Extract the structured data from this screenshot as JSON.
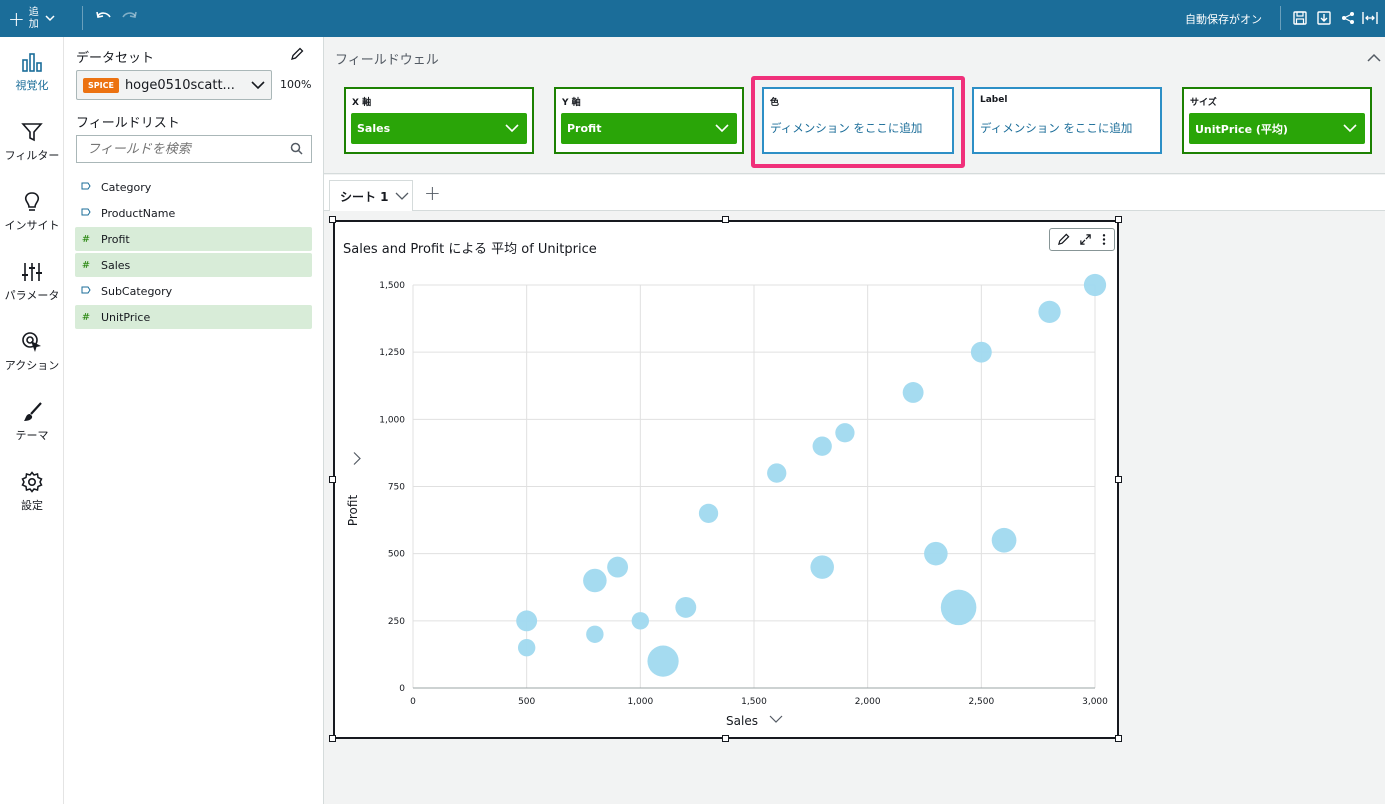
{
  "topbar": {
    "add_label": "追加",
    "autosave": "自動保存がオン"
  },
  "rail": [
    {
      "label": "視覚化",
      "icon": "visualize-icon",
      "active": true
    },
    {
      "label": "フィルター",
      "icon": "filter-icon",
      "active": false
    },
    {
      "label": "インサイト",
      "icon": "lightbulb-icon",
      "active": false
    },
    {
      "label": "パラメータ",
      "icon": "sliders-icon",
      "active": false
    },
    {
      "label": "アクション",
      "icon": "action-cursor-icon",
      "active": false
    },
    {
      "label": "テーマ",
      "icon": "brush-icon",
      "active": false
    },
    {
      "label": "設定",
      "icon": "gear-icon",
      "active": false
    }
  ],
  "datapanel": {
    "dataset_title": "データセット",
    "spice": "SPICE",
    "dataset_name": "hoge0510scatt...",
    "percent": "100%",
    "fieldlist_title": "フィールドリスト",
    "search_placeholder": "フィールドを検索",
    "fields": [
      {
        "name": "Category",
        "type": "dimension"
      },
      {
        "name": "ProductName",
        "type": "dimension"
      },
      {
        "name": "Profit",
        "type": "measure"
      },
      {
        "name": "Sales",
        "type": "measure"
      },
      {
        "name": "SubCategory",
        "type": "dimension"
      },
      {
        "name": "UnitPrice",
        "type": "measure"
      }
    ]
  },
  "wells": {
    "title": "フィールドウェル",
    "items": [
      {
        "label": "X 軸",
        "value": "Sales",
        "filled": true
      },
      {
        "label": "Y 軸",
        "value": "Profit",
        "filled": true
      },
      {
        "label": "色",
        "value": "ディメンション をここに追加",
        "filled": false
      },
      {
        "label": "Label",
        "value": "ディメンション をここに追加",
        "filled": false
      },
      {
        "label": "サイズ",
        "value": "UnitPrice (平均)",
        "filled": true
      }
    ]
  },
  "sheet": {
    "tab_label": "シート 1"
  },
  "colors": {
    "topbar": "#1b6d99",
    "well_green": "#2aa508",
    "highlight": "#f0307a",
    "bubble": "#a0d9ef"
  },
  "chart_data": {
    "type": "scatter",
    "title": "Sales and Profit による 平均 of Unitprice",
    "xlabel": "Sales",
    "ylabel": "Profit",
    "xlim": [
      0,
      3000
    ],
    "ylim": [
      0,
      1500
    ],
    "x_ticks": [
      "0",
      "500",
      "1,000",
      "1,500",
      "2,000",
      "2,500",
      "3,000"
    ],
    "y_ticks": [
      "0",
      "250",
      "500",
      "750",
      "1,000",
      "1,250",
      "1,500"
    ],
    "grid": true,
    "points": [
      {
        "x": 500,
        "y": 250,
        "size": 2
      },
      {
        "x": 500,
        "y": 150,
        "size": 1
      },
      {
        "x": 800,
        "y": 400,
        "size": 3
      },
      {
        "x": 800,
        "y": 200,
        "size": 1
      },
      {
        "x": 900,
        "y": 450,
        "size": 2
      },
      {
        "x": 1000,
        "y": 250,
        "size": 1
      },
      {
        "x": 1100,
        "y": 100,
        "size": 7
      },
      {
        "x": 1200,
        "y": 300,
        "size": 2
      },
      {
        "x": 1300,
        "y": 650,
        "size": 1.5
      },
      {
        "x": 1600,
        "y": 800,
        "size": 1.5
      },
      {
        "x": 1800,
        "y": 900,
        "size": 1.5
      },
      {
        "x": 1800,
        "y": 450,
        "size": 3
      },
      {
        "x": 1900,
        "y": 950,
        "size": 1.5
      },
      {
        "x": 2200,
        "y": 1100,
        "size": 2
      },
      {
        "x": 2300,
        "y": 500,
        "size": 3
      },
      {
        "x": 2400,
        "y": 300,
        "size": 10
      },
      {
        "x": 2500,
        "y": 1250,
        "size": 2
      },
      {
        "x": 2600,
        "y": 550,
        "size": 3.5
      },
      {
        "x": 2800,
        "y": 1400,
        "size": 2.5
      },
      {
        "x": 3000,
        "y": 1500,
        "size": 2.5
      }
    ]
  }
}
